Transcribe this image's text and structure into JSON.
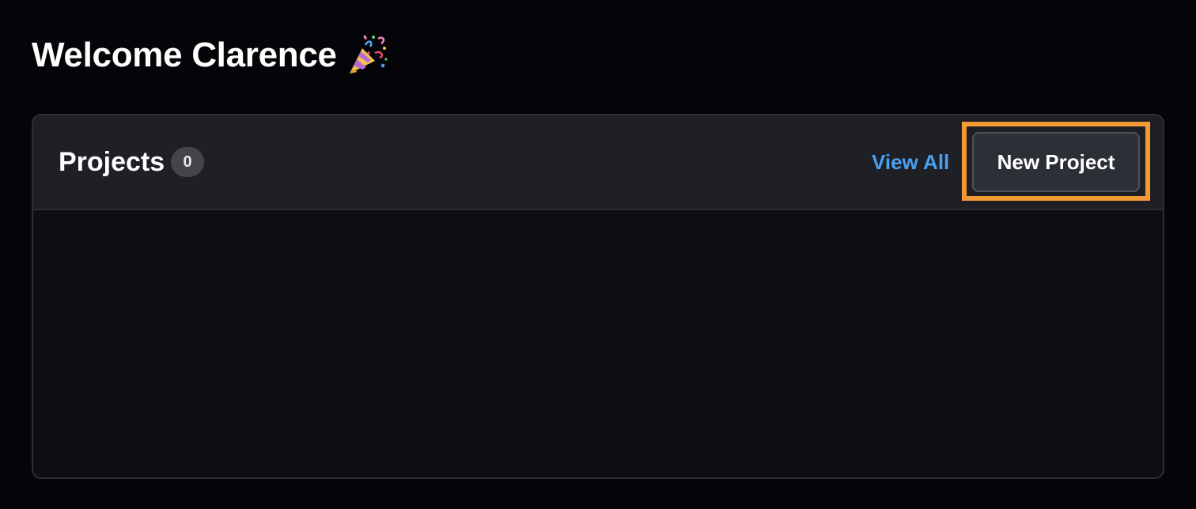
{
  "welcome": {
    "title": "Welcome Clarence",
    "icon": "party-popper-icon"
  },
  "projects": {
    "title": "Projects",
    "count": "0",
    "view_all_label": "View All",
    "new_project_label": "New Project",
    "items": []
  },
  "colors": {
    "background": "#050509",
    "card_header": "#1f2025",
    "card_body": "#0e0f13",
    "link_blue": "#4a9ff0",
    "highlight_orange": "#f39a34",
    "button_bg": "#2d2f37"
  }
}
